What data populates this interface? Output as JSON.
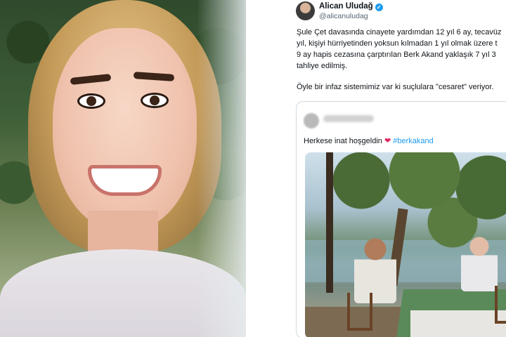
{
  "tweet": {
    "author_name": "Alican Uludağ",
    "author_handle": "@alicanuludag",
    "lines": [
      "Şule Çet davasında cinayete yardımdan 12 yıl 6 ay, tecavüz",
      "yıl, kişiyi hürriyetinden yoksun kılmadan 1 yıl olmak üzere t",
      "9 ay hapis cezasına çarptırılan Berk Akand yaklaşık 7 yıl 3",
      "tahliye edilmiş."
    ],
    "last_line": "Öyle bir infaz sistemimiz var ki suçlulara \"cesaret\" veriyor.",
    "quoted": {
      "text_before": "Herkese inat hoşgeldin",
      "heart": "❤",
      "hashtag": "#berkakand"
    }
  },
  "colors": {
    "link": "#1d9bf0",
    "verified": "#1d9bf0",
    "heart": "#e0245e",
    "text": "#0f1419",
    "secondary": "#536471"
  },
  "icons": [
    "verified-badge-icon",
    "heart-emoji-icon"
  ]
}
